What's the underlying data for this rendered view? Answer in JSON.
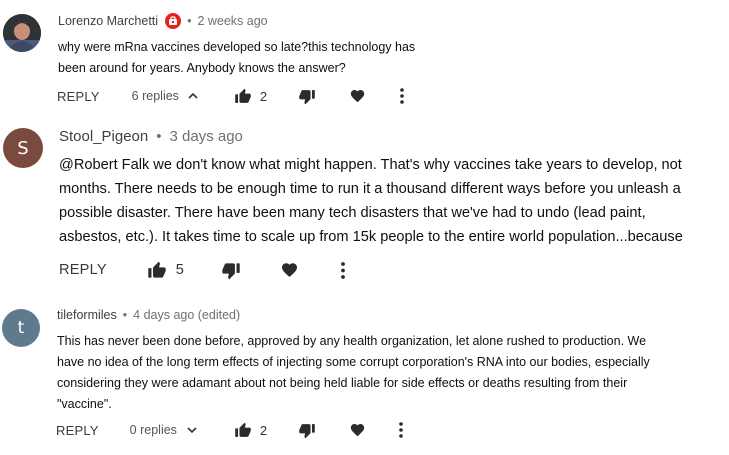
{
  "comments": [
    {
      "author": "Lorenzo Marchetti",
      "separator": "•",
      "time": "2 weeks ago",
      "text_lines": [
        "why were mRna vaccines developed so late?this technology has",
        "been around for years. Anybody knows the answer?"
      ],
      "reply_label": "REPLY",
      "replies_label": "6 replies",
      "likes": "2",
      "has_badge": true
    },
    {
      "author": "Stool_Pigeon",
      "separator": "•",
      "time": "3 days ago",
      "avatar_letter": "S",
      "avatar_color": "#7a4a3e",
      "text_lines": [
        "@Robert Falk we don't know what might happen. That's why vaccines take years to develop, not",
        "months. There needs to be enough time to run it a thousand different ways before you unleash a",
        "possible disaster. There have been many tech disasters that we've had to undo (lead paint,",
        "asbestos, etc.). It takes time to scale up from 15k people to the entire world population...because"
      ],
      "reply_label": "REPLY",
      "likes": "5"
    },
    {
      "author": "tileformiles",
      "separator": "•",
      "time": "4 days ago (edited)",
      "avatar_letter": "t",
      "avatar_color": "#5f7a8c",
      "text_lines": [
        "This has never been done before, approved by any health organization, let alone rushed to production. We",
        "have no idea of the long term effects of injecting some corrupt corporation's RNA into our bodies, especially",
        "considering they were adamant about not being held liable for side effects or deaths resulting from their",
        "\"vaccine\"."
      ],
      "reply_label": "REPLY",
      "replies_label": "0 replies",
      "likes": "2"
    }
  ],
  "icons": {
    "like": "thumb-up-icon",
    "dislike": "thumb-down-icon",
    "heart": "heart-icon",
    "more": "more-vertical-icon",
    "badge": "channel-badge-icon",
    "chevron_up": "chevron-up-icon",
    "chevron_down": "chevron-down-icon"
  },
  "colors": {
    "badge": "#e62117",
    "icon": "#2b2b2b"
  }
}
